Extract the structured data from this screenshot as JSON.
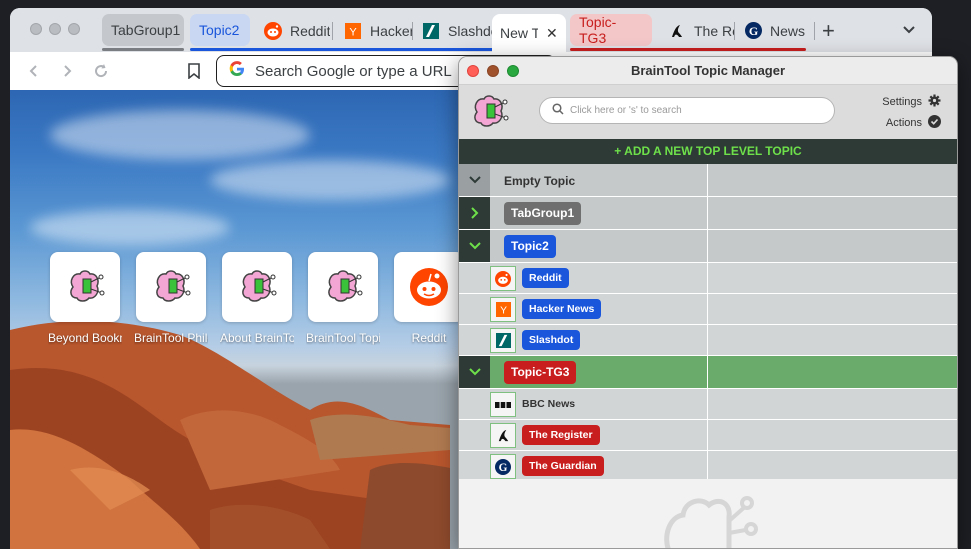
{
  "browser": {
    "tabs": [
      {
        "group": "TabGroup1"
      },
      {
        "group": "Topic2"
      },
      {
        "title": "Reddit",
        "icon": "reddit-icon"
      },
      {
        "title": "Hacker News",
        "icon": "hacker-news-icon"
      },
      {
        "title": "Slashdot",
        "icon": "slashdot-icon"
      },
      {
        "title": "New Tab",
        "active": true
      },
      {
        "group": "Topic-TG3"
      },
      {
        "title": "The Register",
        "icon": "register-icon"
      },
      {
        "title": "News",
        "icon": "guardian-icon"
      }
    ],
    "new_tab_label": "+",
    "omnibox_placeholder": "Search Google or type a URL",
    "shortcuts": [
      {
        "label": "Beyond Bookmarks",
        "icon": "braintool-icon"
      },
      {
        "label": "BrainTool Philosophy",
        "icon": "braintool-icon"
      },
      {
        "label": "About BrainTool",
        "icon": "braintool-icon"
      },
      {
        "label": "BrainTool Topic Manager",
        "icon": "braintool-icon"
      },
      {
        "label": "Reddit",
        "icon": "reddit-icon"
      }
    ]
  },
  "braintool": {
    "window_title": "BrainTool Topic Manager",
    "search_placeholder": "Click here or 's' to search",
    "settings_label": "Settings",
    "actions_label": "Actions",
    "add_topic_label": "+ ADD A NEW TOP LEVEL TOPIC",
    "rows": [
      {
        "type": "topic",
        "title": "Empty Topic",
        "expanded": true,
        "style": "plain"
      },
      {
        "type": "topic",
        "title": "TabGroup1",
        "expanded": false,
        "color": "#6f6f6f"
      },
      {
        "type": "topic",
        "title": "Topic2",
        "expanded": true,
        "color": "#1a56db"
      },
      {
        "type": "link",
        "title": "Reddit",
        "color": "#1a56db",
        "icon": "reddit-icon"
      },
      {
        "type": "link",
        "title": "Hacker News",
        "color": "#1a56db",
        "icon": "hacker-news-icon"
      },
      {
        "type": "link",
        "title": "Slashdot",
        "color": "#1a56db",
        "icon": "slashdot-icon"
      },
      {
        "type": "topic",
        "title": "Topic-TG3",
        "expanded": true,
        "color": "#c81e1e",
        "selected": true
      },
      {
        "type": "link",
        "title": "BBC News",
        "style": "plain",
        "icon": "bbc-icon"
      },
      {
        "type": "link",
        "title": "The Register",
        "color": "#c81e1e",
        "icon": "register-icon"
      },
      {
        "type": "link",
        "title": "The Guardian",
        "color": "#c81e1e",
        "icon": "guardian-icon"
      }
    ]
  },
  "colors": {
    "topic2_group": "#1a56db",
    "tg3_group": "#c81e1e",
    "tabgroup1": "#6f6f6f",
    "bt_dark": "#2d3a36",
    "bt_green_text": "#6ee04a",
    "selected_row": "#6aaa6a"
  }
}
